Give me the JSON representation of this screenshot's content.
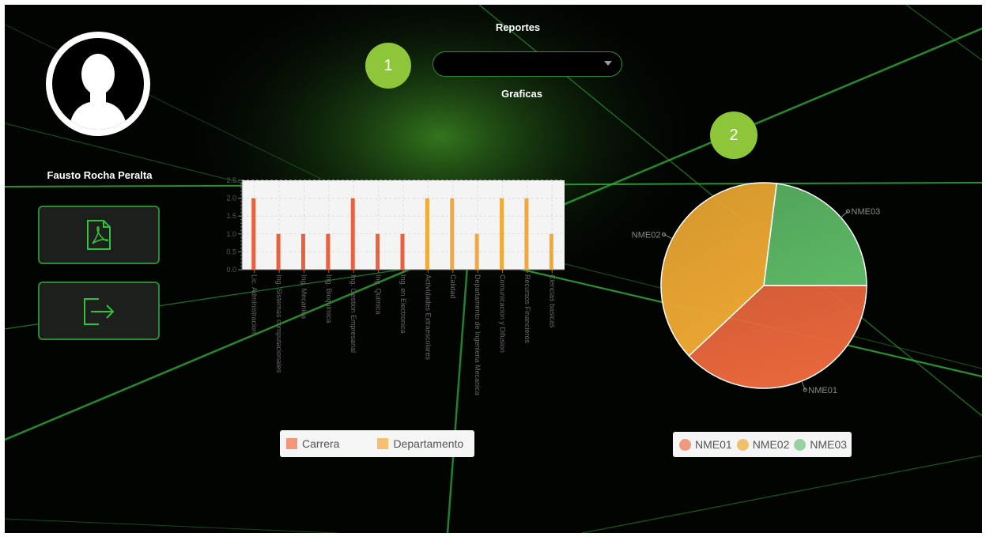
{
  "user": {
    "name": "Fausto Rocha Peralta"
  },
  "sidebar": {
    "pdf_button_icon": "pdf-file-icon",
    "logout_button_icon": "exit-arrow-icon"
  },
  "header": {
    "reportes_label": "Reportes",
    "graficas_label": "Graficas",
    "report_select_value": ""
  },
  "badges": {
    "first": "1",
    "second": "2"
  },
  "colors": {
    "accent": "#2d8f31",
    "badge": "#8ec639",
    "carrera": "#e8603c",
    "departamento": "#f2a93b",
    "nme01": "#e8663c",
    "nme02": "#eaa632",
    "nme03": "#5bb563"
  },
  "chart_data": [
    {
      "type": "bar",
      "categories": [
        "Lic. Administracion",
        "Ing. Sistemas computacionales",
        "Ing. Mecanica",
        "Ing. Bioquimica",
        "Ing. Gestion Empresarial",
        "Ing. Quimica",
        "Ing. en Electronica",
        "Actividades Extraescolares",
        "Calidad",
        "Departamento de Ingenieria Mecanica",
        "Comunicacion y Difusion",
        "Recursos Financieros",
        "Ciencias basicas"
      ],
      "series": [
        {
          "name": "Carrera",
          "values": [
            2,
            1,
            1,
            1,
            2,
            1,
            1,
            0,
            0,
            0,
            0,
            0,
            0
          ]
        },
        {
          "name": "Departamento",
          "values": [
            0,
            0,
            0,
            0,
            0,
            0,
            0,
            2,
            2,
            1,
            2,
            2,
            1
          ]
        }
      ],
      "yticks": [
        "0.0",
        "0.5",
        "1.0",
        "1.5",
        "2.0",
        "2.5"
      ],
      "ylim": [
        0,
        2.5
      ],
      "grid": true,
      "legend": "bottom"
    },
    {
      "type": "pie",
      "labels": [
        "NME01",
        "NME02",
        "NME03"
      ],
      "values": [
        38,
        39,
        23
      ],
      "legend": "bottom"
    }
  ]
}
